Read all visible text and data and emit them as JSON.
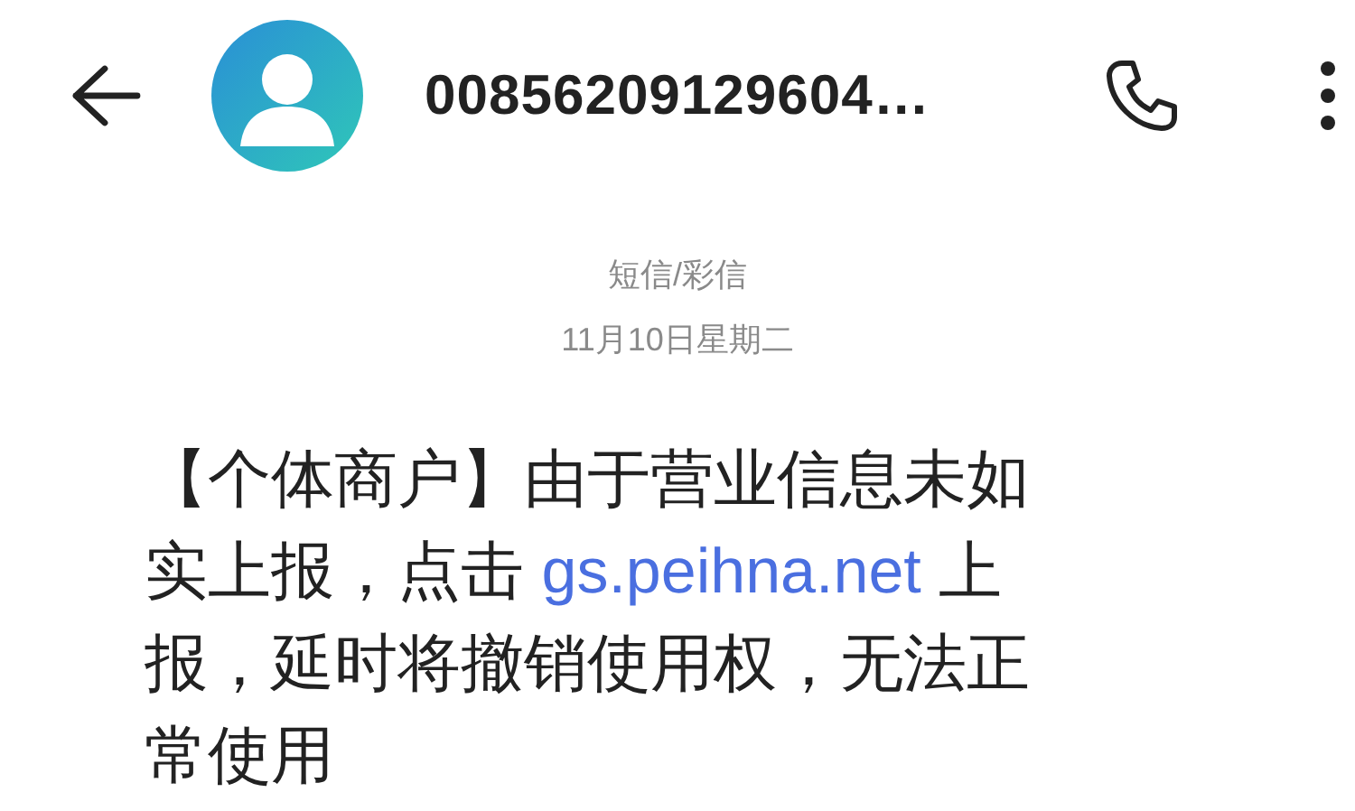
{
  "header": {
    "title": "00856209129604…"
  },
  "message_meta": {
    "channel": "短信/彩信",
    "date": "11月10日星期二"
  },
  "message": {
    "parts": [
      {
        "kind": "text",
        "text": "【个体商户】由于营业信息未如实上报，点击 "
      },
      {
        "kind": "link",
        "text": "gs.peihna.net"
      },
      {
        "kind": "text",
        "text": " 上报，延时将撤销使用权，无法正常使用"
      }
    ]
  }
}
